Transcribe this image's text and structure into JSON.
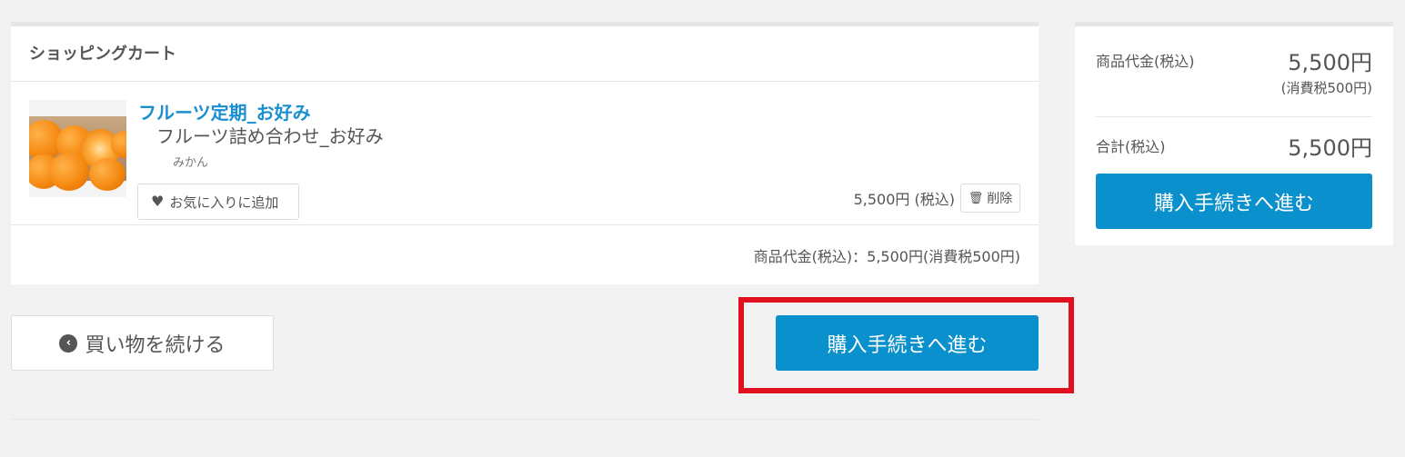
{
  "cart": {
    "title": "ショッピングカート",
    "item": {
      "name": "フルーツ定期_お好み",
      "subname": "フルーツ詰め合わせ_お好み",
      "variant": "みかん",
      "favorite_label": "お気に入りに追加",
      "price": "5,500円 (税込)",
      "delete_label": "削除"
    },
    "subtotal": "商品代金(税込)：5,500円(消費税500円)"
  },
  "actions": {
    "continue_label": "買い物を続ける",
    "checkout_label": "購入手続きへ進む"
  },
  "summary": {
    "subtotal_label": "商品代金(税込)",
    "subtotal_value": "5,500円",
    "tax_note": "(消費税500円)",
    "total_label": "合計(税込)",
    "total_value": "5,500円",
    "checkout_label": "購入手続きへ進む"
  },
  "colors": {
    "accent": "#0a90cd",
    "link": "#1a8fd0",
    "highlight": "#e0101e"
  },
  "icons": {
    "favorite": "heart-icon",
    "delete": "trash-icon",
    "continue": "chevron-left-icon"
  }
}
